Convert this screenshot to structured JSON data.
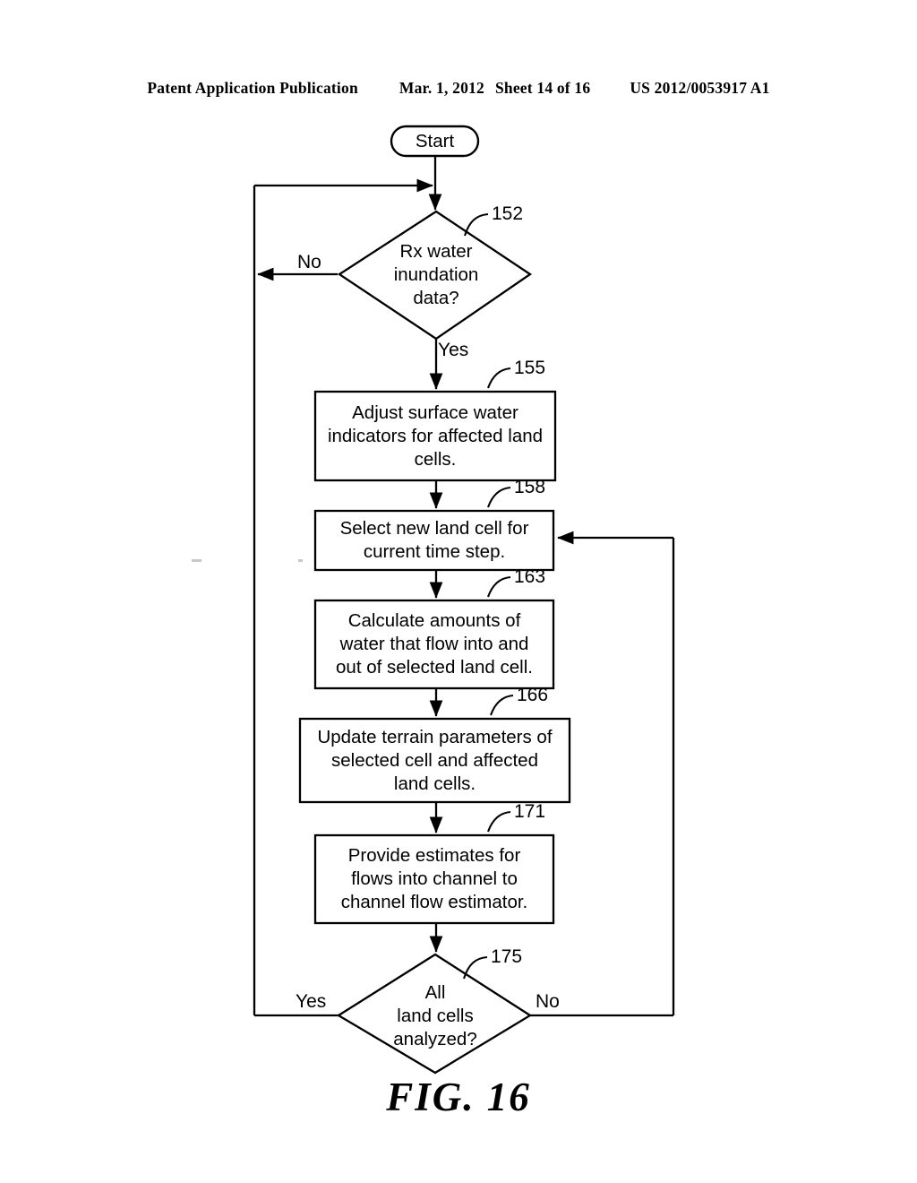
{
  "header": {
    "publication": "Patent Application Publication",
    "date": "Mar. 1, 2012",
    "sheet": "Sheet 14 of 16",
    "docnum": "US 2012/0053917 A1"
  },
  "figure": {
    "caption": "FIG. 16"
  },
  "nodes": {
    "start": {
      "label": "Start",
      "shape": "stadium"
    },
    "decision_152": {
      "ref": "152",
      "label": "Rx water inundation data?",
      "lines": [
        "Rx water",
        "inundation",
        "data?"
      ],
      "shape": "diamond",
      "yes_label": "Yes",
      "no_label": "No"
    },
    "step_155": {
      "ref": "155",
      "label": "Adjust surface water indicators for affected land cells.",
      "lines": [
        "Adjust surface water",
        "indicators for affected land",
        "cells."
      ],
      "shape": "rect"
    },
    "step_158": {
      "ref": "158",
      "label": "Select new land cell for current time step.",
      "lines": [
        "Select new land cell for",
        "current time step."
      ],
      "shape": "rect"
    },
    "step_163": {
      "ref": "163",
      "label": "Calculate amounts of water that flow into and out of selected land cell.",
      "lines": [
        "Calculate amounts of",
        "water that flow into and",
        "out of selected land cell."
      ],
      "shape": "rect"
    },
    "step_166": {
      "ref": "166",
      "label": "Update terrain parameters of selected cell and affected land cells.",
      "lines": [
        "Update terrain parameters of",
        "selected cell and affected",
        "land cells."
      ],
      "shape": "rect"
    },
    "step_171": {
      "ref": "171",
      "label": "Provide estimates for flows into channel to channel flow estimator.",
      "lines": [
        "Provide estimates for",
        "flows into channel to",
        "channel flow estimator."
      ],
      "shape": "rect"
    },
    "decision_175": {
      "ref": "175",
      "label": "All land cells analyzed?",
      "lines": [
        "All",
        "land cells",
        "analyzed?"
      ],
      "shape": "diamond",
      "yes_label": "Yes",
      "no_label": "No"
    }
  },
  "colors": {
    "ink": "#000000",
    "paper": "#ffffff"
  }
}
